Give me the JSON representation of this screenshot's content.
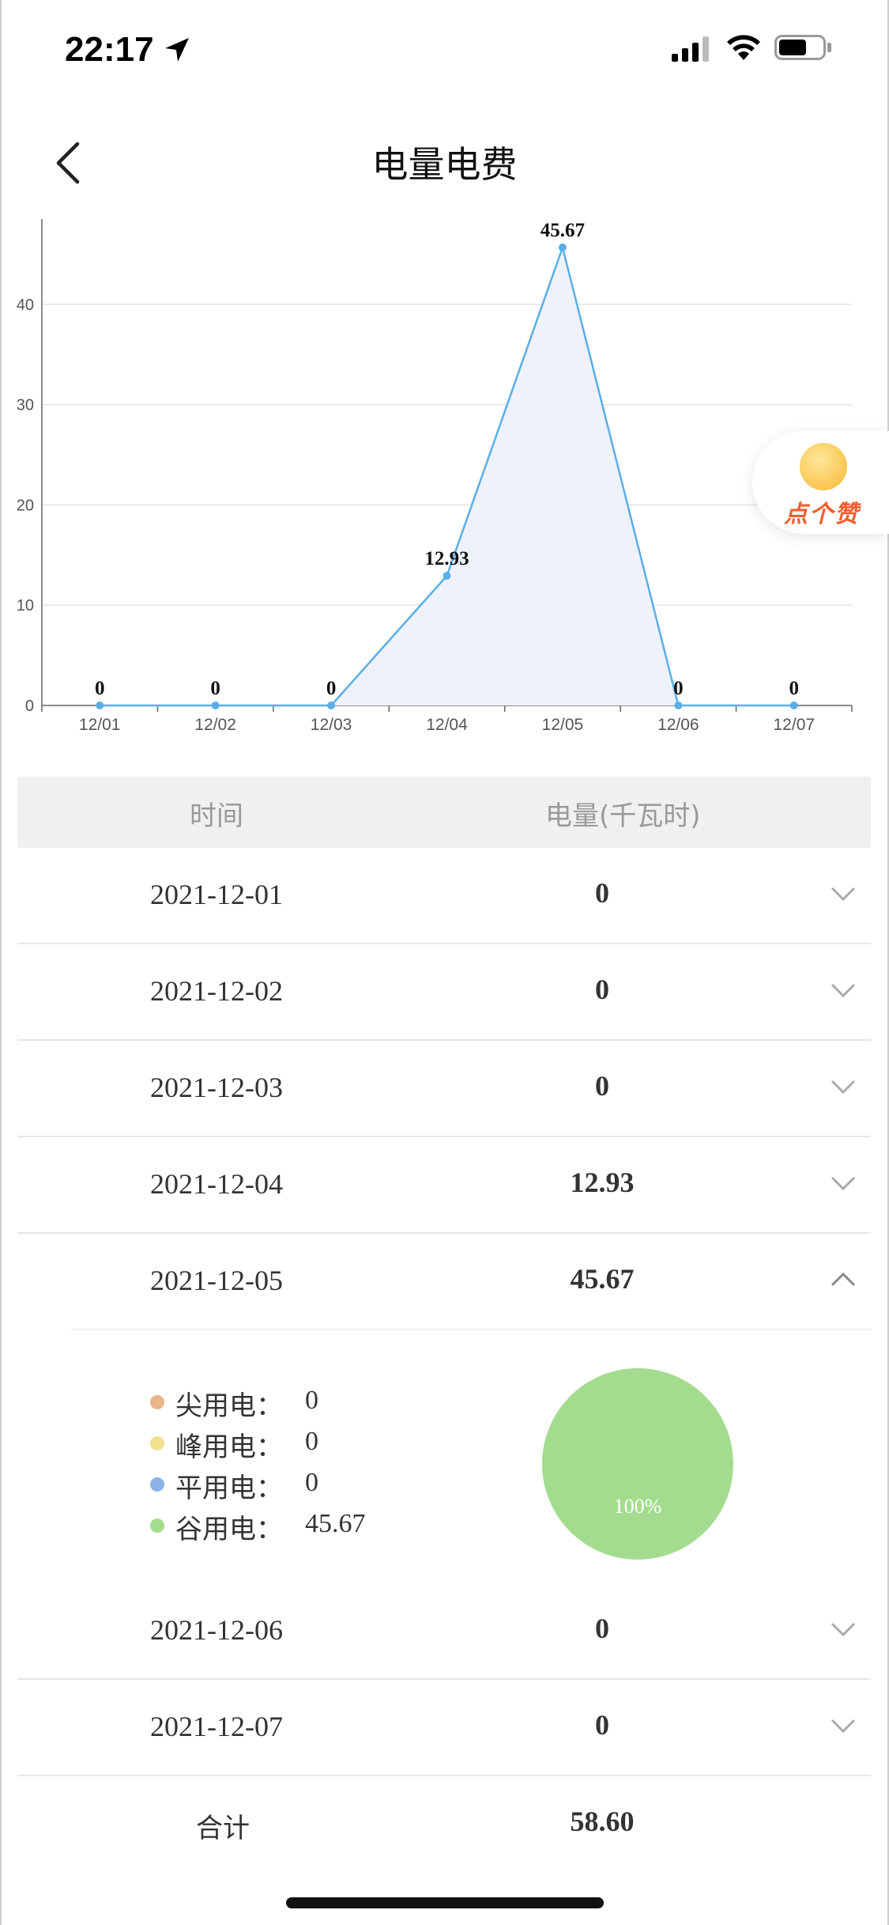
{
  "status_bar": {
    "time": "22:17"
  },
  "nav": {
    "title": "电量电费"
  },
  "chart_data": {
    "type": "area",
    "categories": [
      "12/01",
      "12/02",
      "12/03",
      "12/04",
      "12/05",
      "12/06",
      "12/07"
    ],
    "values": [
      0,
      0,
      0,
      12.93,
      45.67,
      0,
      0
    ],
    "data_labels": [
      "0",
      "0",
      "0",
      "12.93",
      "45.67",
      "0",
      "0"
    ],
    "y_ticks": [
      "0",
      "10",
      "20",
      "30",
      "40"
    ],
    "ylim": [
      0,
      48.5
    ],
    "grid": true,
    "line_color": "#5aaee6",
    "fill_color": "#eef2fa"
  },
  "like_badge": {
    "text": "点个赞"
  },
  "table": {
    "headers": {
      "time": "时间",
      "energy": "电量(千瓦时)"
    },
    "rows": [
      {
        "date": "2021-12-01",
        "value": "0"
      },
      {
        "date": "2021-12-02",
        "value": "0"
      },
      {
        "date": "2021-12-03",
        "value": "0"
      },
      {
        "date": "2021-12-04",
        "value": "12.93"
      },
      {
        "date": "2021-12-05",
        "value": "45.67"
      },
      {
        "date": "2021-12-06",
        "value": "0"
      },
      {
        "date": "2021-12-07",
        "value": "0"
      }
    ],
    "expanded": {
      "legend": [
        {
          "label": "尖用电：",
          "value": "0",
          "color": "#e8b48a"
        },
        {
          "label": "峰用电：",
          "value": "0",
          "color": "#f2e08e"
        },
        {
          "label": "平用电：",
          "value": "0",
          "color": "#8fb3e8"
        },
        {
          "label": "谷用电：",
          "value": "45.67",
          "color": "#a3dc8f"
        }
      ],
      "pie_label": "100%"
    },
    "total": {
      "label": "合计",
      "value": "58.60"
    }
  }
}
